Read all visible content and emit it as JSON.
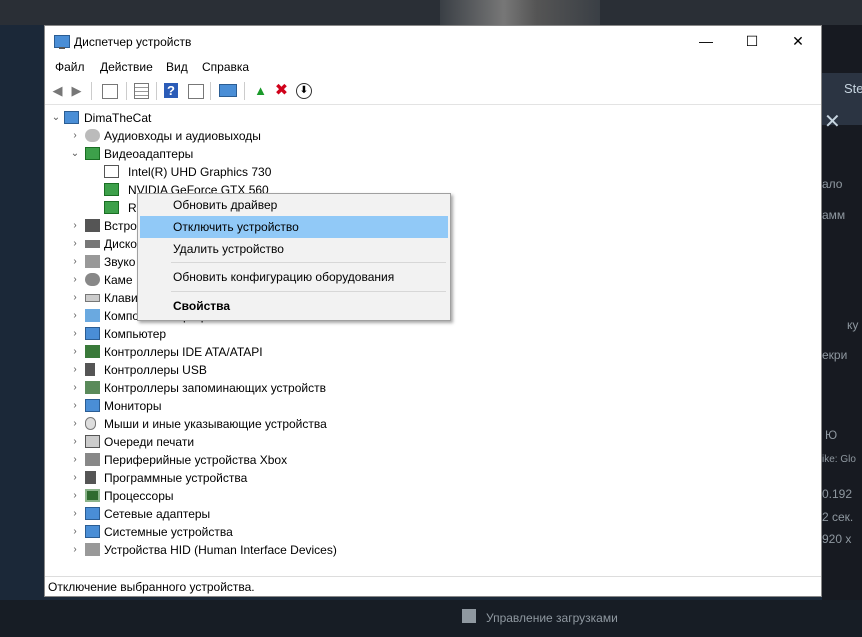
{
  "background_app": {
    "right_tab_text": "Ste",
    "right_close": "✕",
    "right_fragments": [
      "ало",
      "амм",
      "ку",
      "екри",
      "Ю",
      "ike: Glo",
      "0.192",
      "2 сек.",
      "920 x"
    ],
    "download_label": "Управление загрузками"
  },
  "window": {
    "title": "Диспетчер устройств",
    "minimize": "—",
    "maximize": "☐",
    "close": "✕"
  },
  "menu": [
    "Файл",
    "Действие",
    "Вид",
    "Справка"
  ],
  "toolbar_icons": [
    "back-icon",
    "forward-icon",
    "properties-icon",
    "list-icon",
    "help-icon",
    "view-icon",
    "monitor-icon",
    "update-driver-icon",
    "remove-icon",
    "disable-icon"
  ],
  "tree": {
    "root": "DimaTheCat",
    "categories": [
      {
        "label": "Аудиовходы и аудиовыходы",
        "expanded": false
      },
      {
        "label": "Видеоадаптеры",
        "expanded": true,
        "children": [
          "Intel(R) UHD Graphics 730",
          "NVIDIA GeForce GTX 560",
          "Ra"
        ]
      },
      {
        "label": "Встро",
        "expanded": false
      },
      {
        "label": "Диско",
        "expanded": false
      },
      {
        "label": "Звуко",
        "expanded": false
      },
      {
        "label": "Каме",
        "expanded": false
      },
      {
        "label": "Клави",
        "expanded": false
      },
      {
        "label": "Компоненты программного обеспечения",
        "expanded": false
      },
      {
        "label": "Компьютер",
        "expanded": false
      },
      {
        "label": "Контроллеры IDE ATA/ATAPI",
        "expanded": false
      },
      {
        "label": "Контроллеры USB",
        "expanded": false
      },
      {
        "label": "Контроллеры запоминающих устройств",
        "expanded": false
      },
      {
        "label": "Мониторы",
        "expanded": false
      },
      {
        "label": "Мыши и иные указывающие устройства",
        "expanded": false
      },
      {
        "label": "Очереди печати",
        "expanded": false
      },
      {
        "label": "Периферийные устройства Xbox",
        "expanded": false
      },
      {
        "label": "Программные устройства",
        "expanded": false
      },
      {
        "label": "Процессоры",
        "expanded": false
      },
      {
        "label": "Сетевые адаптеры",
        "expanded": false
      },
      {
        "label": "Системные устройства",
        "expanded": false
      },
      {
        "label": "Устройства HID (Human Interface Devices)",
        "expanded": false
      }
    ]
  },
  "context_menu": {
    "items": [
      "Обновить драйвер",
      "Отключить устройство",
      "Удалить устройство",
      "Обновить конфигурацию оборудования",
      "Свойства"
    ],
    "highlighted": "Отключить устройство"
  },
  "status": "Отключение выбранного устройства.",
  "colors": {
    "highlight": "#91c9f7",
    "selection": "#cce8ff",
    "remove_red": "#d0021b",
    "help_blue": "#2b5cb8"
  }
}
